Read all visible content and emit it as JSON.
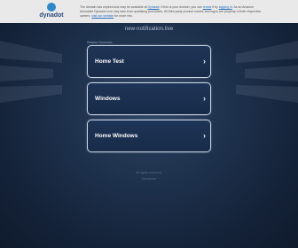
{
  "topbar": {
    "logo_label": "dynadot",
    "notice_text": "The domain has expired and may be available at",
    "notice_link1": "Dynadot",
    "notice_text2": ". If this is your domain, you can",
    "notice_link2": "renew",
    "notice_text3": "it by",
    "notice_link3": "logging in",
    "notice_text4": ". As an Amazon Associate Dynadot.com may earn from qualifying purchases. All third-party product names and logos are property of their respective owners.",
    "notice_link4": "visit our website",
    "notice_text5": "for more info."
  },
  "main": {
    "domain_title": "new-notification.live",
    "related_label": "Related Searches",
    "links": [
      {
        "label": "Home Test"
      },
      {
        "label": "Windows"
      },
      {
        "label": "Home Windows"
      }
    ],
    "chevron": "›"
  },
  "footer": {
    "line1": "All rights reserved.",
    "line2": "Disclaimer"
  },
  "colors": {
    "background": "#1d304b",
    "card_border": "#c9d4e4",
    "topbar": "#e9e9e9"
  }
}
